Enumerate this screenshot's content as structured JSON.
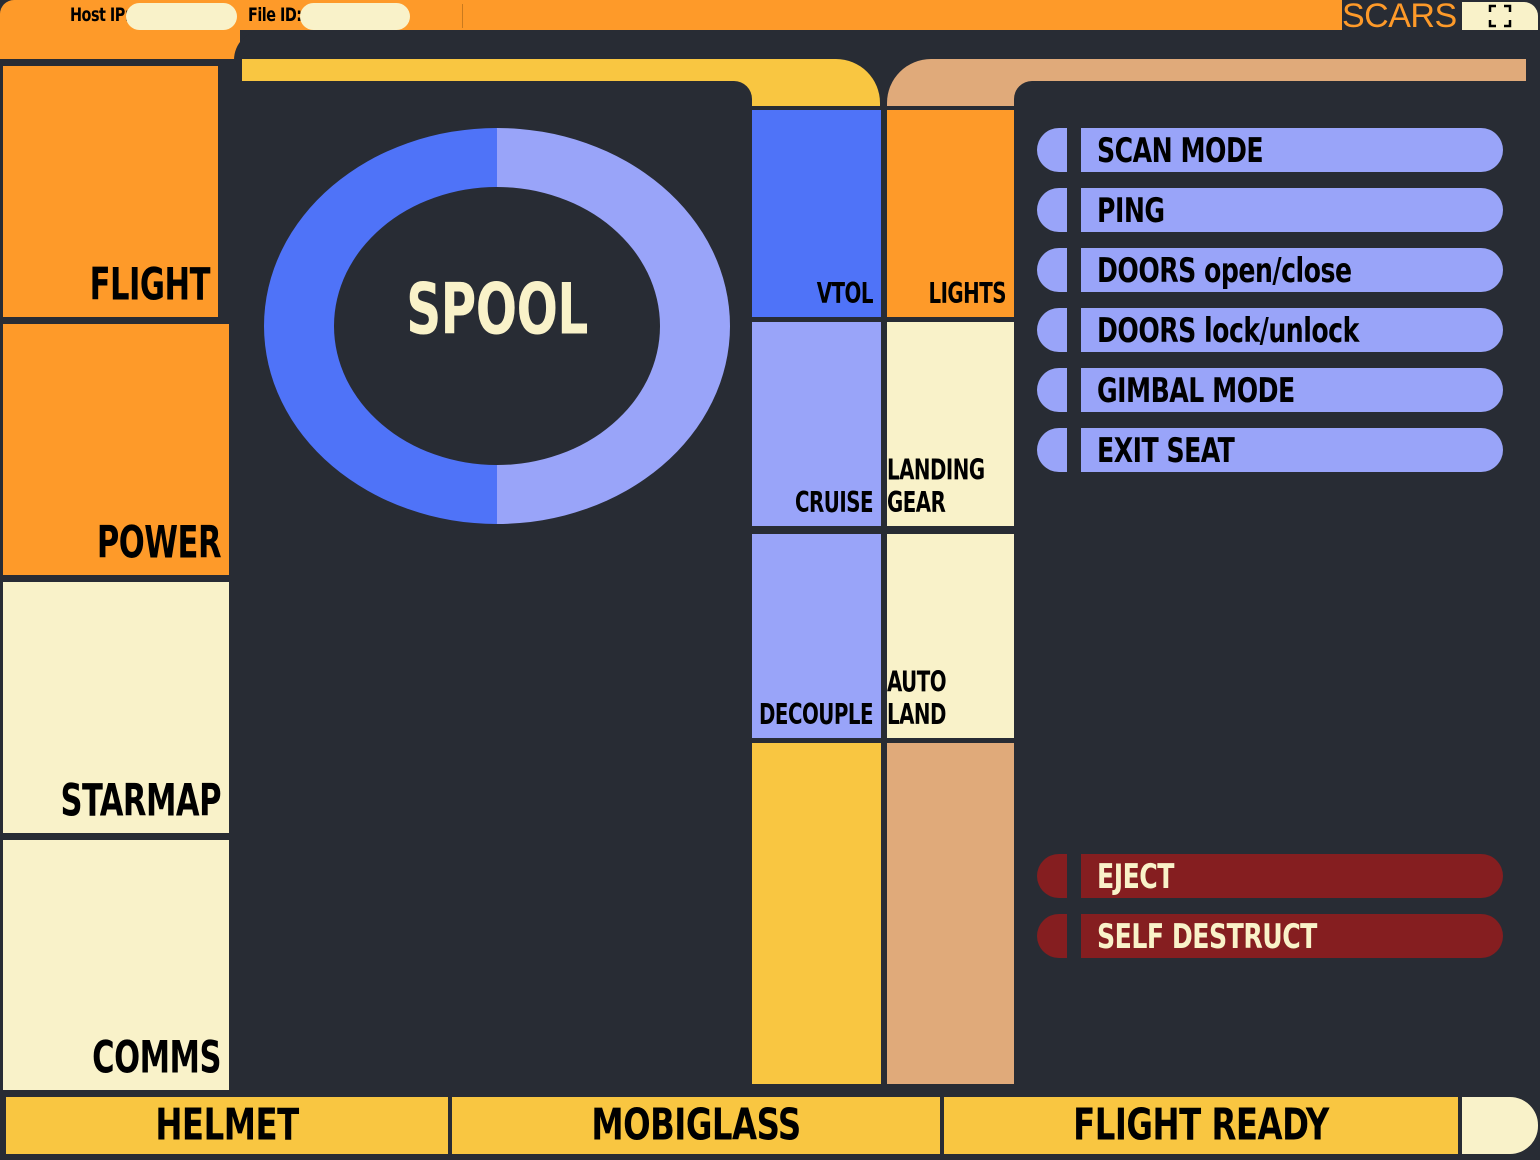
{
  "header": {
    "host_label": "Host IP:",
    "host_value": "",
    "file_label": "File ID:",
    "file_value": "",
    "brand": "SCARS",
    "fullscreen_icon": "fullscreen-icon"
  },
  "left_panel": {
    "items": [
      {
        "label": "FLIGHT"
      },
      {
        "label": "POWER"
      },
      {
        "label": "STARMAP"
      },
      {
        "label": "COMMS"
      }
    ]
  },
  "spool": {
    "label": "SPOOL",
    "progress": 0.5
  },
  "mid_left": {
    "items": [
      {
        "label": "VTOL"
      },
      {
        "label": "CRUISE"
      },
      {
        "label": "DECOUPLE"
      },
      {
        "label": ""
      }
    ]
  },
  "mid_right": {
    "items": [
      {
        "label": "LIGHTS"
      },
      {
        "label": "LANDING GEAR"
      },
      {
        "label": "AUTO LAND"
      },
      {
        "label": ""
      }
    ]
  },
  "right_menu": {
    "items": [
      {
        "label": "SCAN MODE"
      },
      {
        "label": "PING"
      },
      {
        "label": "DOORS open/close"
      },
      {
        "label": "DOORS lock/unlock"
      },
      {
        "label": "GIMBAL MODE"
      },
      {
        "label": "EXIT SEAT"
      }
    ],
    "danger": [
      {
        "label": "EJECT"
      },
      {
        "label": "SELF DESTRUCT"
      }
    ]
  },
  "bottom_bar": {
    "items": [
      {
        "label": "HELMET"
      },
      {
        "label": "MOBIGLASS"
      },
      {
        "label": "FLIGHT READY"
      }
    ]
  },
  "colors": {
    "orange": "#fe9a29",
    "yellow": "#f9c641",
    "cream": "#f9f2c9",
    "blue": "#4f73f8",
    "lavender": "#99a4f9",
    "tan": "#e0aa7a",
    "red": "#851e20",
    "background": "#282c34"
  }
}
